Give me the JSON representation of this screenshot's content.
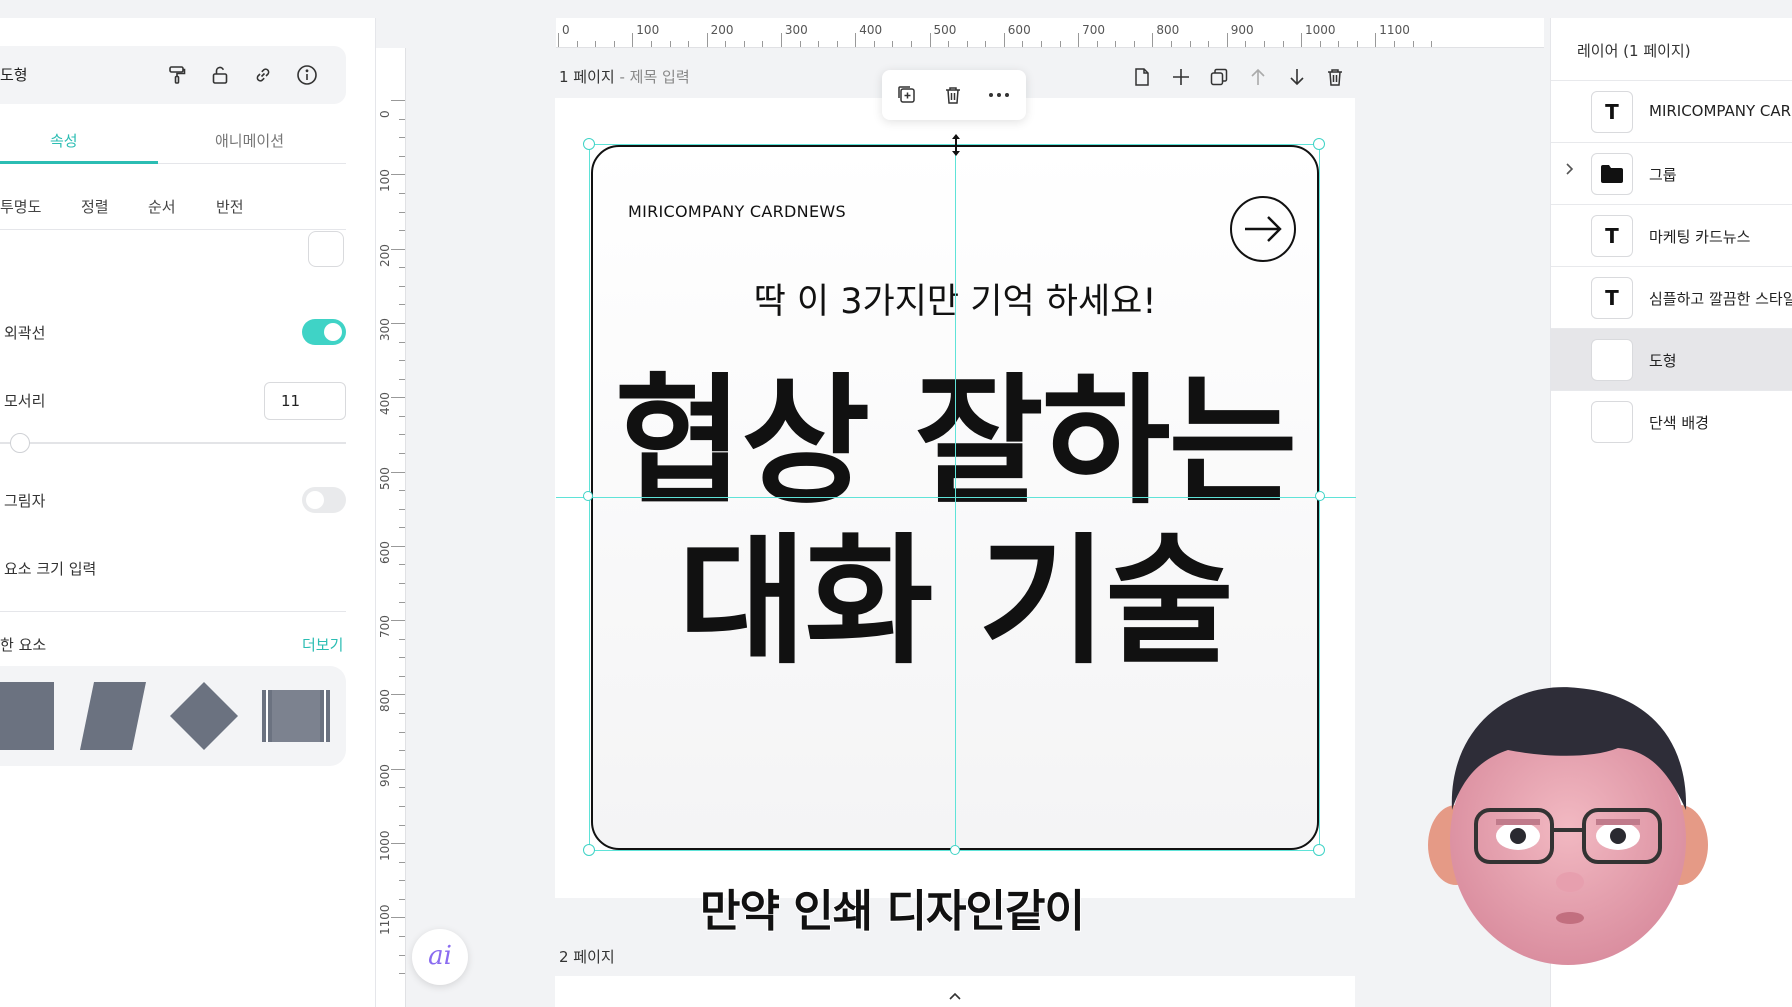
{
  "left_panel": {
    "title": "도형",
    "tabs": [
      {
        "label": "속성"
      },
      {
        "label": "애니메이션"
      }
    ],
    "subtabs": [
      {
        "label": "투명도"
      },
      {
        "label": "정렬"
      },
      {
        "label": "순서"
      },
      {
        "label": "반전"
      }
    ],
    "rows": {
      "outline": {
        "label": "외곽선",
        "on": true
      },
      "corner": {
        "label": "모서리",
        "value": "11"
      },
      "shadow": {
        "label": "그림자",
        "on": false
      },
      "size_input": {
        "label": "요소 크기 입력"
      }
    },
    "similar": {
      "label": "한 요소",
      "more": "더보기"
    },
    "ai_button": "ai"
  },
  "ruler": {
    "top": [
      "0",
      "100",
      "200",
      "300",
      "400",
      "500",
      "600",
      "700",
      "800",
      "900",
      "1000",
      "1100"
    ],
    "left": [
      "0",
      "100",
      "200",
      "300",
      "400",
      "500",
      "600",
      "700",
      "800",
      "900",
      "1000",
      "1100"
    ]
  },
  "canvas": {
    "page1_label": "1 페이지",
    "page1_sub": " - 제목 입력",
    "page2_label": "2 페이지",
    "card": {
      "brand": "MIRICOMPANY CARDNEWS",
      "subtitle": "딱 이 3가지만 기억 하세요!",
      "title_line1": "협상 잘하는",
      "title_line2": "대화 기술"
    }
  },
  "video_subtitle": "만약 인쇄 디자인같이",
  "right_panel": {
    "title": "레이어 (1 페이지)",
    "layers": [
      {
        "name": "MIRICOMPANY CARDNEWS",
        "type": "text"
      },
      {
        "name": "그룹",
        "type": "group"
      },
      {
        "name": "마케팅 카드뉴스",
        "type": "text"
      },
      {
        "name": "심플하고 깔끔한 스타일",
        "type": "text"
      },
      {
        "name": "도형",
        "type": "shape",
        "selected": true
      },
      {
        "name": "단색 배경",
        "type": "shape"
      }
    ]
  },
  "colors": {
    "accent": "#2bbdb3",
    "guide": "#5fe3d8",
    "shape_gray": "#6b7280"
  }
}
